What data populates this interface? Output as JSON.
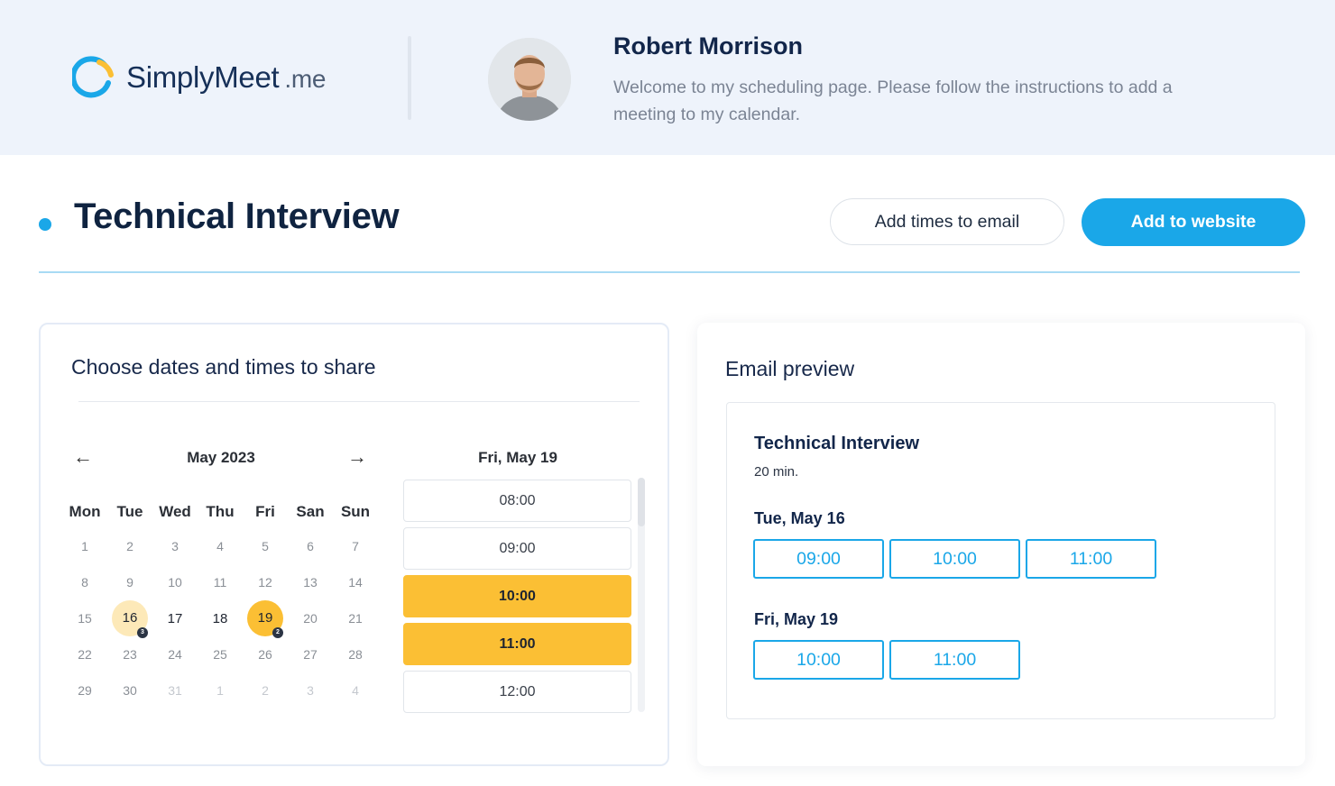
{
  "brand": {
    "name_part1": "Simply",
    "name_part2": "Meet",
    "domain": ".me",
    "accent": "#1aa7e8",
    "secondary": "#fbbf34"
  },
  "host": {
    "name": "Robert Morrison",
    "welcome": "Welcome to my scheduling page. Please follow the instructions to add a meeting to my calendar."
  },
  "page": {
    "title": "Technical Interview",
    "add_times_email_label": "Add times to email",
    "add_website_label": "Add to website"
  },
  "chooser": {
    "title": "Choose dates and times to share",
    "prev_icon": "←",
    "next_icon": "→",
    "month": "May 2023",
    "weekdays": [
      "Mon",
      "Tue",
      "Wed",
      "Thu",
      "Fri",
      "San",
      "Sun"
    ],
    "weeks": [
      [
        "1",
        "2",
        "3",
        "4",
        "5",
        "6",
        "7"
      ],
      [
        "8",
        "9",
        "10",
        "11",
        "12",
        "13",
        "14"
      ],
      [
        "15",
        "16",
        "17",
        "18",
        "19",
        "20",
        "21"
      ],
      [
        "22",
        "23",
        "24",
        "25",
        "26",
        "27",
        "28"
      ],
      [
        "29",
        "30",
        "31",
        "1",
        "2",
        "3",
        "4"
      ]
    ],
    "selected_day": "Fri, May 19",
    "slots": [
      "08:00",
      "09:00",
      "10:00",
      "11:00",
      "12:00"
    ],
    "badges": {
      "16": "3",
      "19": "2"
    }
  },
  "preview": {
    "title": "Email preview",
    "event_title": "Technical Interview",
    "duration": "20 min.",
    "days": [
      {
        "label": "Tue, May 16",
        "times": [
          "09:00",
          "10:00",
          "11:00"
        ]
      },
      {
        "label": "Fri, May 19",
        "times": [
          "10:00",
          "11:00"
        ]
      }
    ]
  }
}
